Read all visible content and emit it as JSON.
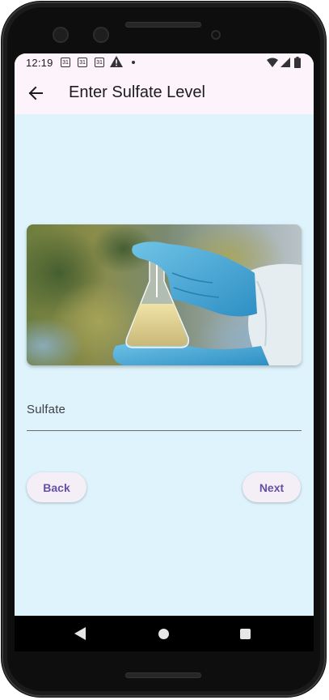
{
  "status_bar": {
    "time": "12:19",
    "calendar_icons": [
      "31",
      "31",
      "31"
    ],
    "icons": [
      "warning-icon",
      "dot-icon",
      "wifi-icon",
      "signal-icon",
      "battery-icon"
    ]
  },
  "app_bar": {
    "back_icon": "arrow-left-icon",
    "title": "Enter Sulfate Level"
  },
  "hero_image": {
    "subject": "gloved-hands-holding-erlenmeyer-flask"
  },
  "form": {
    "sulfate_label": "Sulfate",
    "sulfate_value": ""
  },
  "buttons": {
    "back_label": "Back",
    "next_label": "Next"
  },
  "nav_bar": {
    "icons": [
      "nav-back-icon",
      "nav-home-icon",
      "nav-recents-icon"
    ]
  },
  "colors": {
    "screen_bg": "#def3fc",
    "appbar_bg": "#fdf3fb",
    "button_bg": "#f4eff7",
    "button_text": "#6750a4"
  }
}
